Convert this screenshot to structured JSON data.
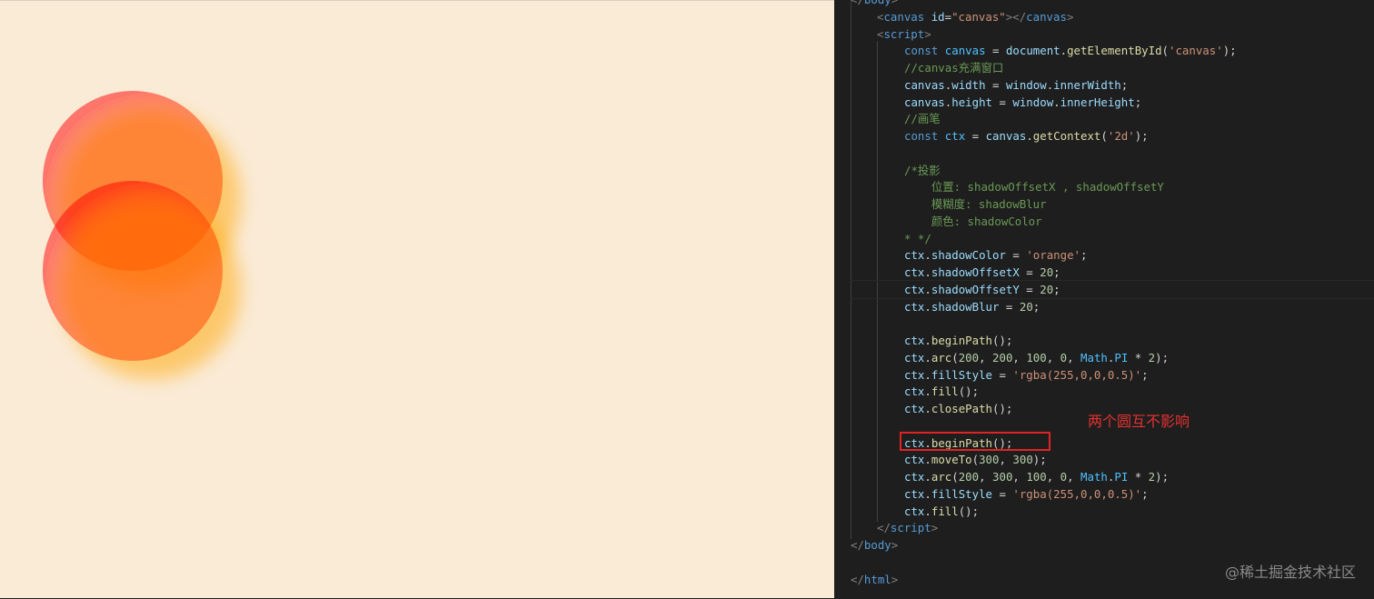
{
  "canvas_preview": {
    "background": "#faebd7",
    "shadow_color": "#ffa500",
    "circle_fill": "rgba(255,0,0,0.5)",
    "circles": [
      "circle-1",
      "circle-2"
    ]
  },
  "code": {
    "lines": [
      [
        [
          "t-punc",
          "</"
        ],
        [
          "t-tag",
          "body"
        ],
        [
          "t-punc",
          ">"
        ]
      ],
      [
        [
          "t-punc",
          "<"
        ],
        [
          "t-tag",
          "canvas"
        ],
        [
          "t-op",
          " "
        ],
        [
          "t-attr",
          "id"
        ],
        [
          "t-op",
          "="
        ],
        [
          "t-str",
          "\"canvas\""
        ],
        [
          "t-punc",
          "></"
        ],
        [
          "t-tag",
          "canvas"
        ],
        [
          "t-punc",
          ">"
        ]
      ],
      [
        [
          "t-punc",
          "<"
        ],
        [
          "t-tag",
          "script"
        ],
        [
          "t-punc",
          ">"
        ]
      ],
      [
        [
          "t-kw",
          "const"
        ],
        [
          "t-op",
          " "
        ],
        [
          "t-const",
          "canvas"
        ],
        [
          "t-op",
          " = "
        ],
        [
          "t-var",
          "document"
        ],
        [
          "t-op",
          "."
        ],
        [
          "t-fn",
          "getElementById"
        ],
        [
          "t-op",
          "("
        ],
        [
          "t-str",
          "'canvas'"
        ],
        [
          "t-op",
          ");"
        ]
      ],
      [
        [
          "t-com",
          "//canvas充满窗口"
        ]
      ],
      [
        [
          "t-var",
          "canvas"
        ],
        [
          "t-op",
          "."
        ],
        [
          "t-var",
          "width"
        ],
        [
          "t-op",
          " = "
        ],
        [
          "t-var",
          "window"
        ],
        [
          "t-op",
          "."
        ],
        [
          "t-var",
          "innerWidth"
        ],
        [
          "t-op",
          ";"
        ]
      ],
      [
        [
          "t-var",
          "canvas"
        ],
        [
          "t-op",
          "."
        ],
        [
          "t-var",
          "height"
        ],
        [
          "t-op",
          " = "
        ],
        [
          "t-var",
          "window"
        ],
        [
          "t-op",
          "."
        ],
        [
          "t-var",
          "innerHeight"
        ],
        [
          "t-op",
          ";"
        ]
      ],
      [
        [
          "t-com",
          "//画笔"
        ]
      ],
      [
        [
          "t-kw",
          "const"
        ],
        [
          "t-op",
          " "
        ],
        [
          "t-const",
          "ctx"
        ],
        [
          "t-op",
          " = "
        ],
        [
          "t-var",
          "canvas"
        ],
        [
          "t-op",
          "."
        ],
        [
          "t-fn",
          "getContext"
        ],
        [
          "t-op",
          "("
        ],
        [
          "t-str",
          "'2d'"
        ],
        [
          "t-op",
          ");"
        ]
      ],
      [],
      [
        [
          "t-com",
          "/*投影"
        ]
      ],
      [
        [
          "t-com",
          "    位置: shadowOffsetX , shadowOffsetY"
        ]
      ],
      [
        [
          "t-com",
          "    模糊度: shadowBlur"
        ]
      ],
      [
        [
          "t-com",
          "    颜色: shadowColor"
        ]
      ],
      [
        [
          "t-com",
          "* */"
        ]
      ],
      [
        [
          "t-var",
          "ctx"
        ],
        [
          "t-op",
          "."
        ],
        [
          "t-var",
          "shadowColor"
        ],
        [
          "t-op",
          " = "
        ],
        [
          "t-str",
          "'orange'"
        ],
        [
          "t-op",
          ";"
        ]
      ],
      [
        [
          "t-var",
          "ctx"
        ],
        [
          "t-op",
          "."
        ],
        [
          "t-var",
          "shadowOffsetX"
        ],
        [
          "t-op",
          " = "
        ],
        [
          "t-num",
          "20"
        ],
        [
          "t-op",
          ";"
        ]
      ],
      [
        [
          "t-var",
          "ctx"
        ],
        [
          "t-op",
          "."
        ],
        [
          "t-var",
          "shadowOffsetY"
        ],
        [
          "t-op",
          " = "
        ],
        [
          "t-num",
          "20"
        ],
        [
          "t-op",
          ";"
        ]
      ],
      [
        [
          "t-var",
          "ctx"
        ],
        [
          "t-op",
          "."
        ],
        [
          "t-var",
          "shadowBlur"
        ],
        [
          "t-op",
          " = "
        ],
        [
          "t-num",
          "20"
        ],
        [
          "t-op",
          ";"
        ]
      ],
      [],
      [
        [
          "t-var",
          "ctx"
        ],
        [
          "t-op",
          "."
        ],
        [
          "t-fn",
          "beginPath"
        ],
        [
          "t-op",
          "();"
        ]
      ],
      [
        [
          "t-var",
          "ctx"
        ],
        [
          "t-op",
          "."
        ],
        [
          "t-fn",
          "arc"
        ],
        [
          "t-op",
          "("
        ],
        [
          "t-num",
          "200"
        ],
        [
          "t-op",
          ", "
        ],
        [
          "t-num",
          "200"
        ],
        [
          "t-op",
          ", "
        ],
        [
          "t-num",
          "100"
        ],
        [
          "t-op",
          ", "
        ],
        [
          "t-num",
          "0"
        ],
        [
          "t-op",
          ", "
        ],
        [
          "t-const",
          "Math"
        ],
        [
          "t-op",
          "."
        ],
        [
          "t-const",
          "PI"
        ],
        [
          "t-op",
          " * "
        ],
        [
          "t-num",
          "2"
        ],
        [
          "t-op",
          ");"
        ]
      ],
      [
        [
          "t-var",
          "ctx"
        ],
        [
          "t-op",
          "."
        ],
        [
          "t-var",
          "fillStyle"
        ],
        [
          "t-op",
          " = "
        ],
        [
          "t-str",
          "'rgba(255,0,0,0.5)'"
        ],
        [
          "t-op",
          ";"
        ]
      ],
      [
        [
          "t-var",
          "ctx"
        ],
        [
          "t-op",
          "."
        ],
        [
          "t-fn",
          "fill"
        ],
        [
          "t-op",
          "();"
        ]
      ],
      [
        [
          "t-var",
          "ctx"
        ],
        [
          "t-op",
          "."
        ],
        [
          "t-fn",
          "closePath"
        ],
        [
          "t-op",
          "();"
        ]
      ],
      [],
      [
        [
          "t-var",
          "ctx"
        ],
        [
          "t-op",
          "."
        ],
        [
          "t-fn",
          "beginPath"
        ],
        [
          "t-op",
          "();"
        ]
      ],
      [
        [
          "t-var",
          "ctx"
        ],
        [
          "t-op",
          "."
        ],
        [
          "t-fn",
          "moveTo"
        ],
        [
          "t-op",
          "("
        ],
        [
          "t-num",
          "300"
        ],
        [
          "t-op",
          ", "
        ],
        [
          "t-num",
          "300"
        ],
        [
          "t-op",
          ");"
        ]
      ],
      [
        [
          "t-var",
          "ctx"
        ],
        [
          "t-op",
          "."
        ],
        [
          "t-fn",
          "arc"
        ],
        [
          "t-op",
          "("
        ],
        [
          "t-num",
          "200"
        ],
        [
          "t-op",
          ", "
        ],
        [
          "t-num",
          "300"
        ],
        [
          "t-op",
          ", "
        ],
        [
          "t-num",
          "100"
        ],
        [
          "t-op",
          ", "
        ],
        [
          "t-num",
          "0"
        ],
        [
          "t-op",
          ", "
        ],
        [
          "t-const",
          "Math"
        ],
        [
          "t-op",
          "."
        ],
        [
          "t-const",
          "PI"
        ],
        [
          "t-op",
          " * "
        ],
        [
          "t-num",
          "2"
        ],
        [
          "t-op",
          ");"
        ]
      ],
      [
        [
          "t-var",
          "ctx"
        ],
        [
          "t-op",
          "."
        ],
        [
          "t-var",
          "fillStyle"
        ],
        [
          "t-op",
          " = "
        ],
        [
          "t-str",
          "'rgba(255,0,0,0.5)'"
        ],
        [
          "t-op",
          ";"
        ]
      ],
      [
        [
          "t-var",
          "ctx"
        ],
        [
          "t-op",
          "."
        ],
        [
          "t-fn",
          "fill"
        ],
        [
          "t-op",
          "();"
        ]
      ],
      [
        [
          "t-punc",
          "</"
        ],
        [
          "t-tag",
          "script"
        ],
        [
          "t-punc",
          ">"
        ]
      ],
      [
        [
          "t-punc",
          "</"
        ],
        [
          "t-tag",
          "body"
        ],
        [
          "t-punc",
          ">"
        ]
      ],
      [],
      [
        [
          "t-punc",
          "</"
        ],
        [
          "t-tag",
          "html"
        ],
        [
          "t-punc",
          ">"
        ]
      ]
    ]
  },
  "annotation": "两个圆互不影响",
  "watermark": "@稀土掘金技术社区",
  "colors": {
    "editor_bg": "#1e1e1e",
    "highlight_box": "#e02424",
    "annotation": "#e53030"
  }
}
